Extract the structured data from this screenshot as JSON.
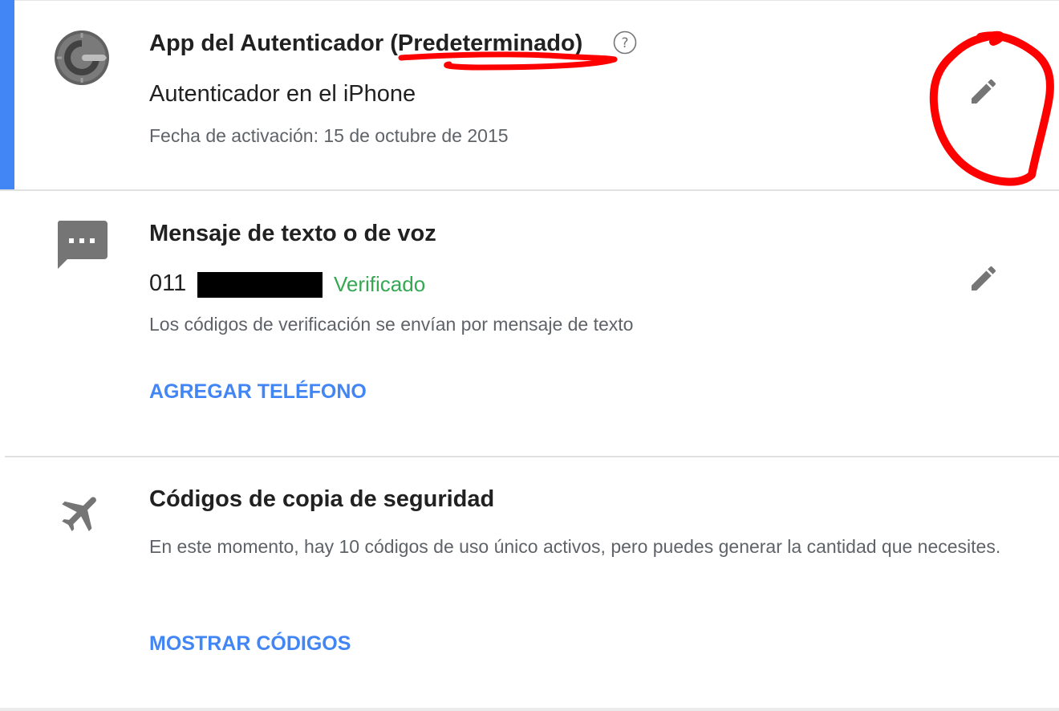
{
  "colors": {
    "accent": "#4285f4",
    "link": "#4285f4",
    "verified": "#34a853",
    "icon_gray": "#757575",
    "annotation_red": "#ff0000"
  },
  "authenticator": {
    "icon": "google-authenticator-icon",
    "title_prefix": "App del Autenticador ",
    "title_default": "(Predeterminado)",
    "help_icon": "help-circle-icon",
    "device": "Autenticador en el iPhone",
    "activation": "Fecha de activación: 15 de octubre de 2015",
    "edit_icon": "pencil-icon"
  },
  "sms": {
    "icon": "message-dots-icon",
    "title": "Mensaje de texto o de voz",
    "phone_prefix": "011",
    "status": "Verificado",
    "description": "Los códigos de verificación se envían por mensaje de texto",
    "add_phone": "AGREGAR TELÉFONO",
    "edit_icon": "pencil-icon"
  },
  "backup": {
    "icon": "airplane-icon",
    "title": "Códigos de copia de seguridad",
    "description": "En este momento, hay 10 códigos de uso único activos, pero puedes generar la cantidad que necesites.",
    "show_codes": "MOSTRAR CÓDIGOS"
  }
}
